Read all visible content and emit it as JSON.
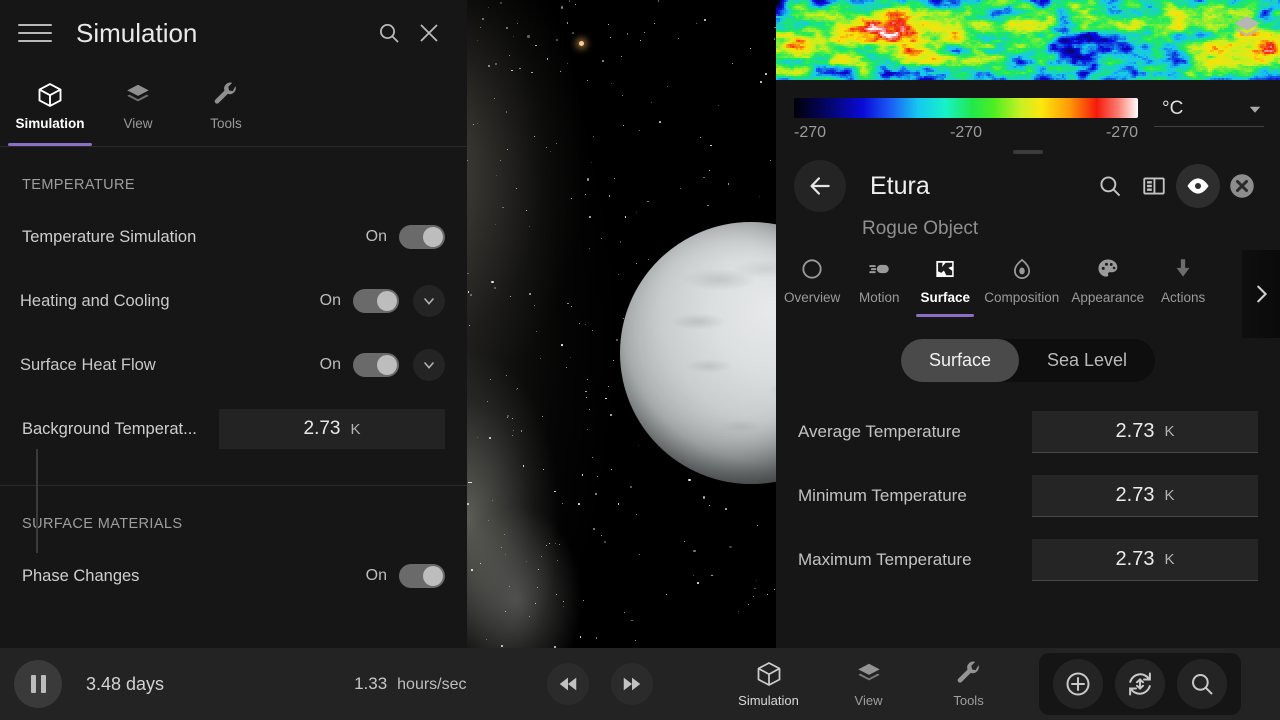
{
  "left_panel": {
    "title": "Simulation",
    "icons": {
      "menu": "hamburger-icon",
      "search": "search-icon",
      "close": "close-icon"
    },
    "tabs": [
      {
        "label": "Simulation",
        "icon": "cube-icon",
        "active": true
      },
      {
        "label": "View",
        "icon": "layers-icon",
        "active": false
      },
      {
        "label": "Tools",
        "icon": "wrench-icon",
        "active": false
      }
    ],
    "sections": [
      {
        "heading": "TEMPERATURE",
        "rows": [
          {
            "label": "Temperature Simulation",
            "state": "On",
            "toggle": true,
            "indent": false,
            "chevron": false
          },
          {
            "label": "Heating and Cooling",
            "state": "On",
            "toggle": true,
            "indent": true,
            "chevron": true
          },
          {
            "label": "Surface Heat Flow",
            "state": "On",
            "toggle": true,
            "indent": true,
            "chevron": true
          }
        ],
        "field": {
          "label": "Background Temperat...",
          "value": "2.73",
          "unit": "K"
        }
      },
      {
        "heading": "SURFACE MATERIALS",
        "rows": [
          {
            "label": "Phase Changes",
            "state": "On",
            "toggle": true,
            "indent": false,
            "chevron": false
          }
        ]
      }
    ]
  },
  "right_panel": {
    "map": {
      "layers_icon": "layers-icon"
    },
    "legend": {
      "ticks": [
        "-270",
        "-270",
        "-270"
      ],
      "unit_value": "°C",
      "gradient": [
        "#000008",
        "#0a0ad8",
        "#16c8f0",
        "#22e84a",
        "#fbe70c",
        "#f51a0c",
        "#ffffff"
      ]
    },
    "object": {
      "name": "Etura",
      "subtitle": "Rogue Object",
      "back_icon": "arrow-left-icon",
      "actions": [
        {
          "name": "search-icon"
        },
        {
          "name": "panel-layout-icon"
        },
        {
          "name": "eye-icon",
          "active": true
        },
        {
          "name": "close-circle-icon"
        }
      ]
    },
    "tabs": [
      {
        "label": "Overview",
        "icon": "circle-icon",
        "active": false
      },
      {
        "label": "Motion",
        "icon": "motion-icon",
        "active": false
      },
      {
        "label": "Surface",
        "icon": "surface-icon",
        "active": true
      },
      {
        "label": "Composition",
        "icon": "composition-icon",
        "active": false
      },
      {
        "label": "Appearance",
        "icon": "palette-icon",
        "active": false
      },
      {
        "label": "Actions",
        "icon": "actions-icon",
        "active": false
      }
    ],
    "next_tab_icon": "chevron-right-icon",
    "segmented": {
      "options": [
        "Surface",
        "Sea Level"
      ],
      "selected": "Surface"
    },
    "measurements": [
      {
        "label": "Average Temperature",
        "value": "2.73",
        "unit": "K"
      },
      {
        "label": "Minimum Temperature",
        "value": "2.73",
        "unit": "K"
      },
      {
        "label": "Maximum Temperature",
        "value": "2.73",
        "unit": "K"
      }
    ]
  },
  "bottom_bar": {
    "play_icon": "pause-icon",
    "elapsed": "3.48 days",
    "rate_value": "1.33",
    "rate_unit": "hours/sec",
    "rewind_icon": "rewind-icon",
    "forward_icon": "fast-forward-icon",
    "tabs": [
      {
        "label": "Simulation",
        "icon": "cube-icon",
        "active": true
      },
      {
        "label": "View",
        "icon": "layers-icon",
        "active": false
      },
      {
        "label": "Tools",
        "icon": "wrench-icon",
        "active": false
      }
    ],
    "fabs": [
      {
        "name": "add-target-icon"
      },
      {
        "name": "orbit-rotate-icon"
      },
      {
        "name": "search-icon"
      }
    ]
  },
  "theme": {
    "accent": "#8a6fc4",
    "panel_bg": "#161616",
    "bar_bg": "#232323"
  }
}
